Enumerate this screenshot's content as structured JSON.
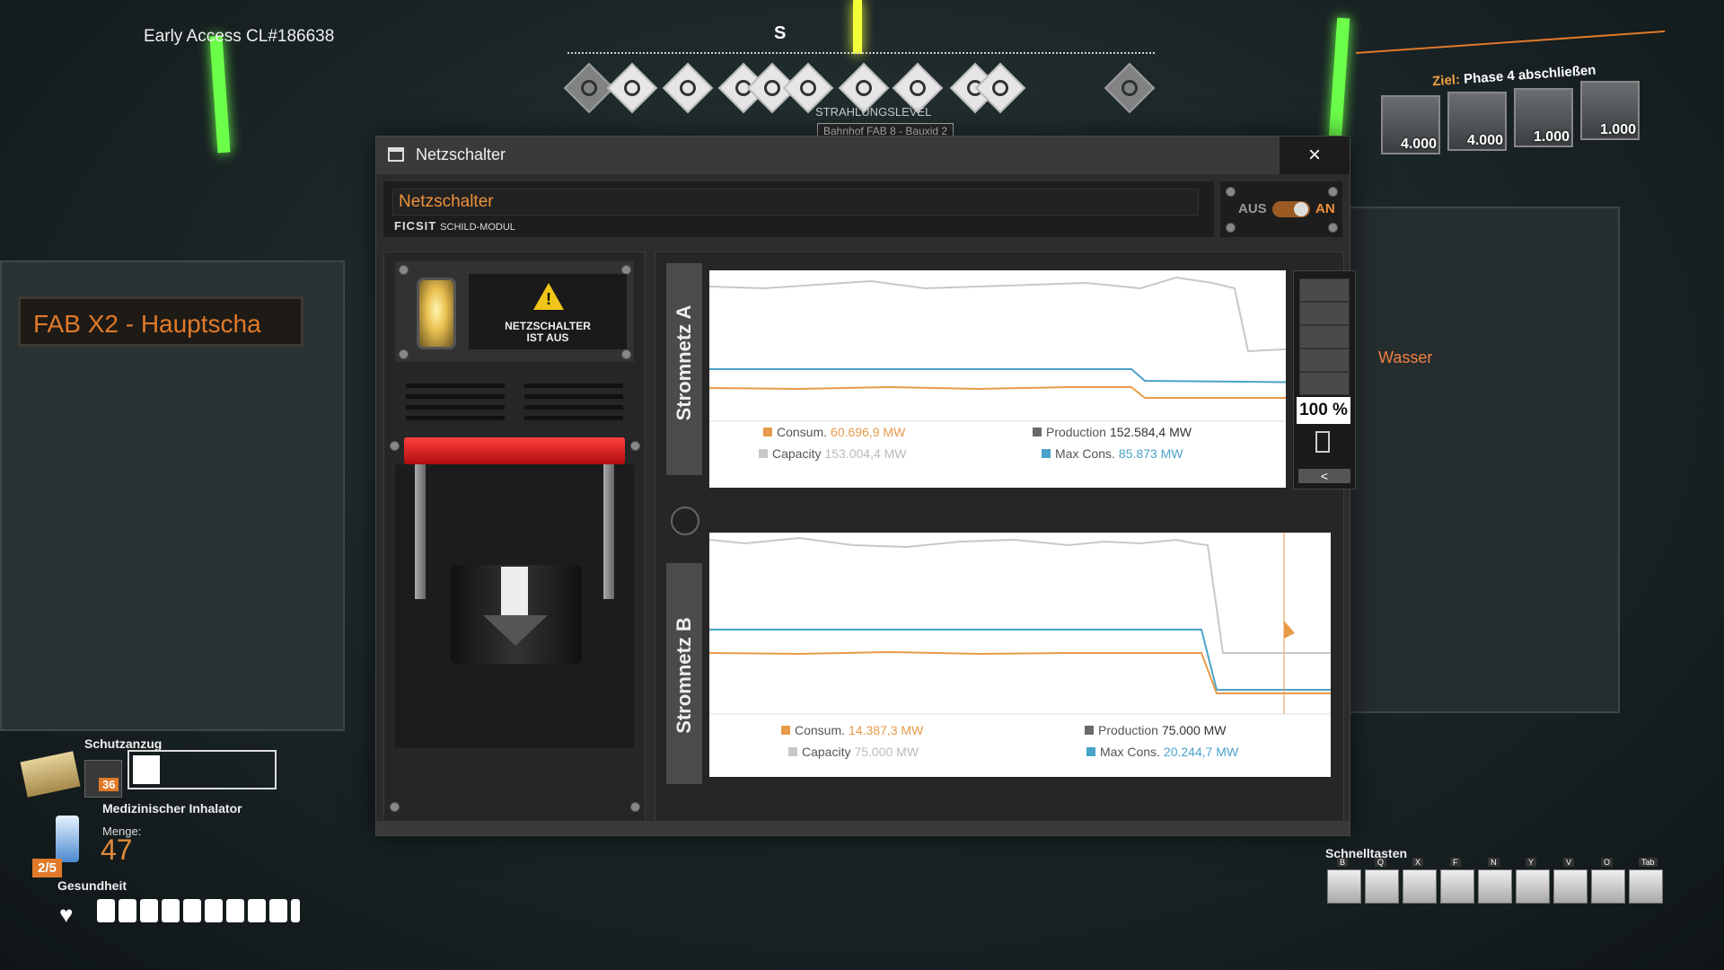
{
  "hud": {
    "build": "Early Access CL#186638",
    "compass_heading": "S",
    "radiation_label": "STRAHLUNGSLEVEL",
    "radiation_sub": "Bahnhof FAB 8 - Bauxid 2",
    "objective": {
      "prefix": "Ziel:",
      "text": "Phase 4 abschließen",
      "items": [
        {
          "count": "4.000"
        },
        {
          "count": "4.000"
        },
        {
          "count": "1.000"
        },
        {
          "count": "1.000"
        }
      ]
    },
    "world_sign": "FAB X2 - Hauptscha",
    "world_label_water": "Wasser",
    "suit_label": "Schutzanzug",
    "suit_count": "36",
    "inhaler_label": "Medizinischer Inhalator",
    "quantity_label": "Menge:",
    "quantity_value": "47",
    "inhaler_slots": "2/5",
    "health_label": "Gesundheit",
    "hotkeys_label": "Schnelltasten",
    "hotkeys": [
      "B",
      "Q",
      "X",
      "F",
      "N",
      "Y",
      "V",
      "O",
      "Tab"
    ]
  },
  "window": {
    "title": "Netzschalter",
    "close_symbol": "×",
    "name_value": "Netzschalter",
    "brand": "FICSIT",
    "module": "SCHILD-MODUL",
    "toggle_off": "AUS",
    "toggle_on": "AN",
    "warning_line1": "NETZSCHALTER",
    "warning_line2": "IST AUS"
  },
  "grid_a": {
    "tab": "Stromnetz A",
    "consum_label": "Consum.",
    "consum_value": "60.696,9 MW",
    "production_label": "Production",
    "production_value": "152.584,4 MW",
    "capacity_label": "Capacity",
    "capacity_value": "153.004,4 MW",
    "maxcons_label": "Max Cons.",
    "maxcons_value": "85.873 MW",
    "battery_percent": "100 %",
    "battery_collapse": "<"
  },
  "grid_b": {
    "tab": "Stromnetz B",
    "consum_label": "Consum.",
    "consum_value": "14.387,3 MW",
    "production_label": "Production",
    "production_value": "75.000 MW",
    "capacity_label": "Capacity",
    "capacity_value": "75.000 MW",
    "maxcons_label": "Max Cons.",
    "maxcons_value": "20.244,7 MW"
  },
  "colors": {
    "accent": "#f0913a",
    "consum": "#e79a4a",
    "capacity": "#c8c8c8",
    "production": "#6a6a6a",
    "maxcons": "#4aa3c8"
  }
}
